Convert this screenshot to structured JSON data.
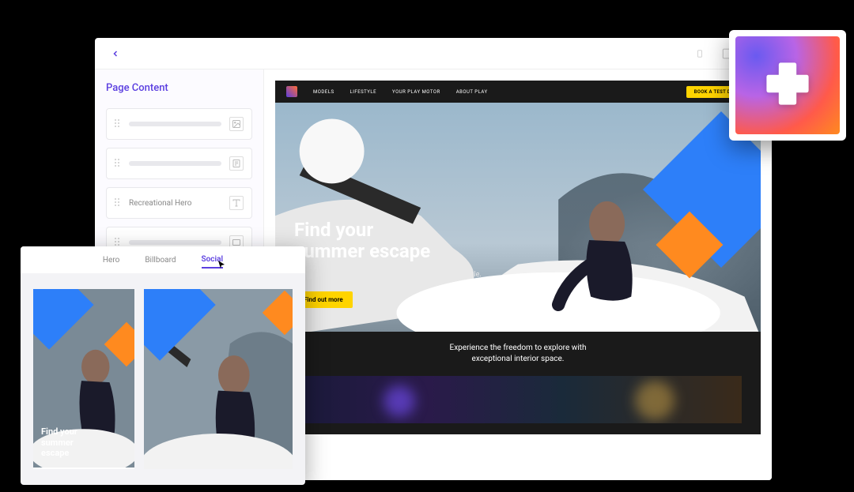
{
  "editor": {
    "sidebar_title": "Page Content",
    "blocks": {
      "named_block_label": "Recreational Hero"
    }
  },
  "site": {
    "nav": [
      "MODELS",
      "LIFESTYLE",
      "YOUR PLAY MOTOR",
      "ABOUT PLAY"
    ],
    "cta": "BOOK A TEST DRIVE"
  },
  "hero": {
    "title_line1": "Find your",
    "title_line2": "summer escape",
    "subtitle": "From the city streets to vacation vistas, anything's possible.",
    "button": "Find out more"
  },
  "below": {
    "line1": "Experience the freedom to explore with",
    "line2": "exceptional interior space."
  },
  "preview": {
    "tabs": [
      "Hero",
      "Billboard",
      "Social"
    ],
    "card_title_line1": "Find your",
    "card_title_line2": "summer",
    "card_title_line3": "escape"
  },
  "colors": {
    "accent": "#5b3fe0",
    "cta_yellow": "#ffd400",
    "shape_blue": "#2d7ff9",
    "shape_orange": "#ff8a1f"
  }
}
